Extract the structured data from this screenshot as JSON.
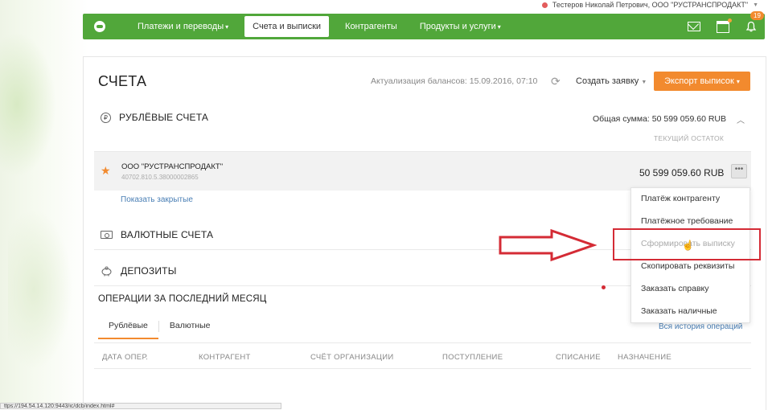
{
  "user": {
    "name": "Тестеров Николай Петрович, ООО \"РУСТРАНСПРОДАКТ\""
  },
  "nav": {
    "items": [
      {
        "label": "Платежи и переводы",
        "dropdown": true,
        "active": false
      },
      {
        "label": "Счета и выписки",
        "dropdown": false,
        "active": true
      },
      {
        "label": "Контрагенты",
        "dropdown": false,
        "active": false
      },
      {
        "label": "Продукты и услуги",
        "dropdown": true,
        "active": false
      }
    ],
    "notifications_count": "19",
    "icons": [
      "mail-icon",
      "calendar-icon",
      "bell-icon"
    ]
  },
  "page": {
    "title": "СЧЕТА",
    "balance_update": "Актуализация балансов: 15.09.2016, 07:10",
    "create_request": "Создать заявку",
    "export_button": "Экспорт выписок"
  },
  "rub_section": {
    "title": "РУБЛЁВЫЕ СЧЕТА",
    "total": "Общая сумма: 50 599 059.60 RUB",
    "column_label": "ТЕКУЩИЙ ОСТАТОК",
    "account": {
      "name": "ООО \"РУСТРАНСПРОДАКТ\"",
      "number": "40702.810.5.38000002865",
      "balance": "50 599 059.60 RUB",
      "actions_label": "•••"
    },
    "show_closed": "Показать закрытые"
  },
  "currency_section": {
    "title": "ВАЛЮТНЫЕ СЧЕТА"
  },
  "deposits_section": {
    "title": "ДЕПОЗИТЫ"
  },
  "operations": {
    "title": "ОПЕРАЦИИ ЗА ПОСЛЕДНИЙ МЕСЯЦ",
    "tabs": [
      "Рублёвые",
      "Валютные"
    ],
    "history_link": "Вся история операций",
    "columns": [
      "ДАТА ОПЕР.",
      "КОНТРАГЕНТ",
      "СЧЁТ ОРГАНИЗАЦИИ",
      "ПОСТУПЛЕНИЕ",
      "СПИСАНИЕ",
      "НАЗНАЧЕНИЕ"
    ]
  },
  "context_menu": {
    "items": [
      {
        "label": "Платёж контрагенту",
        "disabled": false
      },
      {
        "label": "Платёжное требование",
        "disabled": false
      },
      {
        "label": "Сформировать выписку",
        "disabled": true
      },
      {
        "label": "Скопировать реквизиты",
        "disabled": false
      },
      {
        "label": "Заказать справку",
        "disabled": false
      },
      {
        "label": "Заказать наличные",
        "disabled": false
      }
    ]
  },
  "statusbar": {
    "url": "ttps://194.54.14.120:9443/ic/dcb/index.html#"
  },
  "colors": {
    "brand_green": "#51a73a",
    "accent_orange": "#f28a2e",
    "highlight_red": "#d42b35",
    "link_blue": "#4a7fb5"
  }
}
